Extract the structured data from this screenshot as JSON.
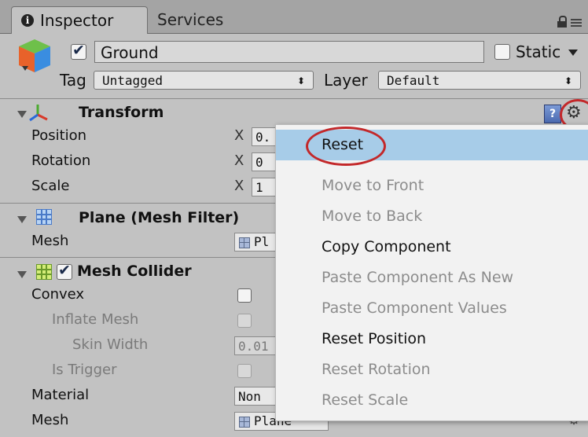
{
  "tabs": [
    {
      "label": "Inspector",
      "active": true
    },
    {
      "label": "Services",
      "active": false
    }
  ],
  "header": {
    "object_name": "Ground",
    "active": true,
    "static_label": "Static",
    "static": false,
    "tag_label": "Tag",
    "tag_value": "Untagged",
    "layer_label": "Layer",
    "layer_value": "Default"
  },
  "transform": {
    "title": "Transform",
    "help_glyph": "?",
    "rows": [
      {
        "label": "Position",
        "axis": "X",
        "value": "0."
      },
      {
        "label": "Rotation",
        "axis": "X",
        "value": "0"
      },
      {
        "label": "Scale",
        "axis": "X",
        "value": "1"
      }
    ]
  },
  "mesh_filter": {
    "title": "Plane (Mesh Filter)",
    "mesh_label": "Mesh",
    "mesh_value": "Pl"
  },
  "mesh_collider": {
    "title": "Mesh Collider",
    "enabled": true,
    "convex_label": "Convex",
    "inflate_label": "Inflate Mesh",
    "skin_width_label": "Skin Width",
    "skin_width_value": "0.01",
    "is_trigger_label": "Is Trigger",
    "material_label": "Material",
    "material_value": "Non",
    "mesh_label": "Mesh",
    "mesh_value": "Plane"
  },
  "context_menu": {
    "items": [
      {
        "label": "Reset",
        "enabled": true,
        "highlighted": true
      },
      {
        "label": "Move to Front",
        "enabled": false
      },
      {
        "label": "Move to Back",
        "enabled": false
      },
      {
        "label": "Copy Component",
        "enabled": true
      },
      {
        "label": "Paste Component As New",
        "enabled": false
      },
      {
        "label": "Paste Component Values",
        "enabled": false
      },
      {
        "label": "Reset Position",
        "enabled": true
      },
      {
        "label": "Reset Rotation",
        "enabled": false
      },
      {
        "label": "Reset Scale",
        "enabled": false
      }
    ]
  },
  "icons": {
    "tab_info": "info-icon",
    "lock": "lock-icon",
    "tab_menu": "menu-icon",
    "game_object": "cube-icon",
    "transform": "axes-icon",
    "mesh_filter": "grid-icon",
    "mesh_collider": "grid-icon",
    "help": "help-icon",
    "settings": "gear-icon"
  },
  "colors": {
    "panel_bg": "#c2c2c2",
    "tab_bar_bg": "#a4a4a4",
    "menu_bg": "#f2f2f2",
    "menu_highlight": "#a7cce8",
    "annotation": "#c3282a",
    "disabled_text": "#8c8c8c"
  }
}
